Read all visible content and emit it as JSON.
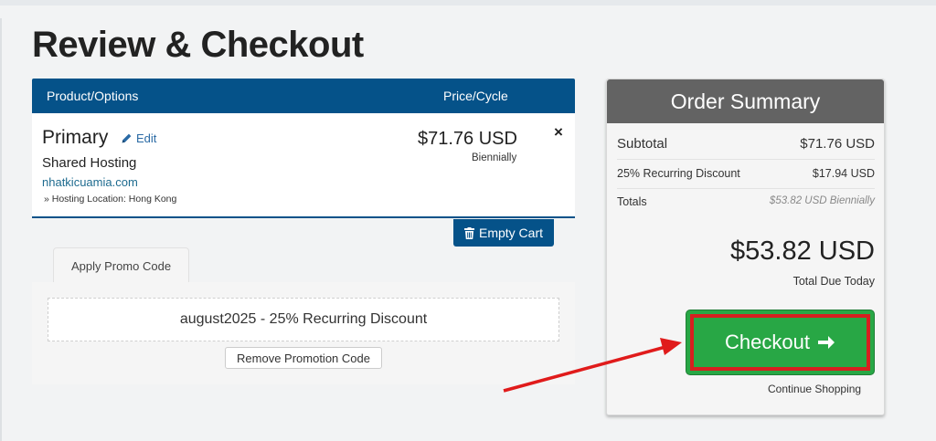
{
  "page": {
    "title": "Review & Checkout"
  },
  "cart": {
    "header": {
      "product": "Product/Options",
      "price": "Price/Cycle"
    },
    "item": {
      "name": "Primary",
      "edit_label": "Edit",
      "group": "Shared Hosting",
      "domain": "nhatkicuamia.com",
      "config": "» Hosting Location: Hong Kong",
      "price": "$71.76 USD",
      "cycle": "Biennially",
      "remove_glyph": "×"
    },
    "empty_cart_label": "Empty Cart"
  },
  "promo": {
    "tab_label": "Apply Promo Code",
    "applied_text": "august2025 - 25% Recurring Discount",
    "remove_label": "Remove Promotion Code"
  },
  "summary": {
    "title": "Order Summary",
    "rows": [
      {
        "label": "Subtotal",
        "value": "$71.76 USD"
      },
      {
        "label": "25% Recurring Discount",
        "value": "$17.94 USD"
      },
      {
        "label": "Totals",
        "value": "$53.82 USD Biennially"
      }
    ],
    "total_amount": "$53.82 USD",
    "total_label": "Total Due Today",
    "checkout_label": "Checkout",
    "continue_label": "Continue Shopping"
  },
  "icons": {
    "edit": "pencil-icon",
    "trash": "trash-icon",
    "checkout_arrow": "arrow-right-icon",
    "remove": "close-icon"
  },
  "colors": {
    "header_blue": "#055289",
    "checkout_green": "#28a745",
    "highlight_red": "#d61f1f",
    "summary_head": "#636363"
  }
}
